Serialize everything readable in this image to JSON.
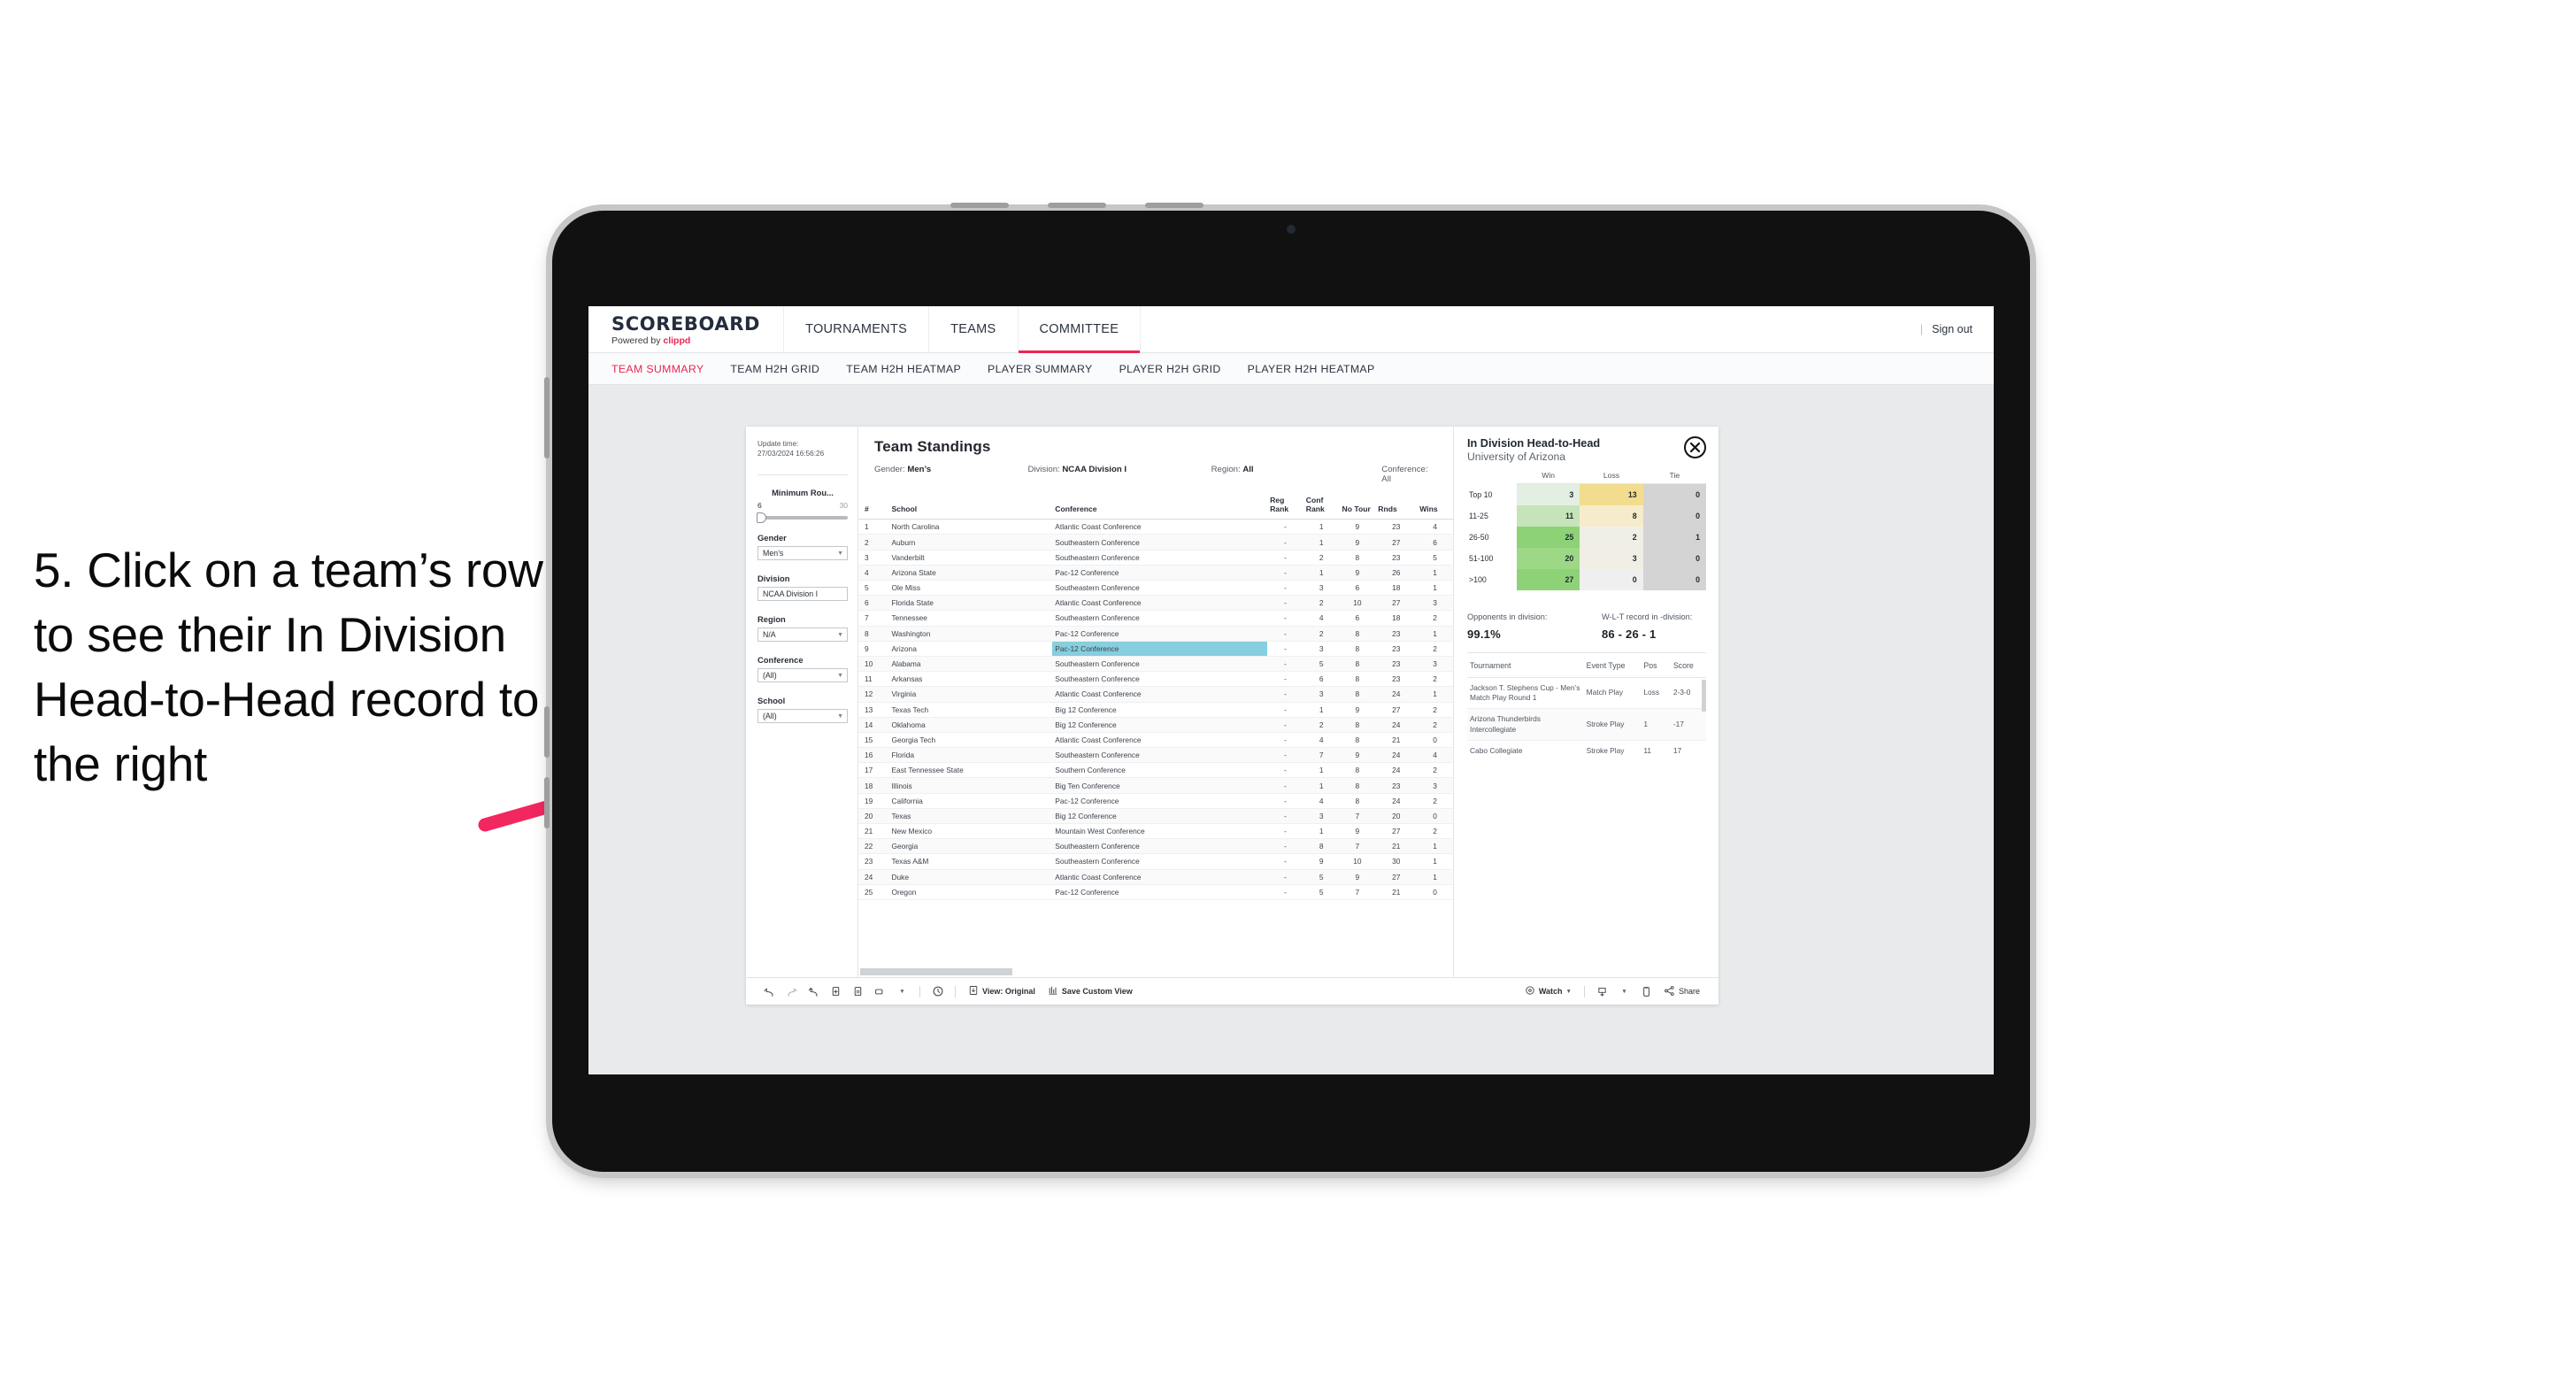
{
  "annotation": {
    "text": "5. Click on a team’s row to see their In Division Head-to-Head record to the right",
    "arrow_color": "#f2275f"
  },
  "app": {
    "brand": {
      "title": "SCOREBOARD",
      "powered_prefix": "Powered by ",
      "powered_brand": "clippd"
    },
    "top_nav": [
      {
        "label": "TOURNAMENTS",
        "active": false
      },
      {
        "label": "TEAMS",
        "active": false
      },
      {
        "label": "COMMITTEE",
        "active": true
      }
    ],
    "header_right": {
      "divider": "|",
      "sign_out": "Sign out"
    },
    "subtabs": [
      {
        "label": "TEAM SUMMARY",
        "active": true
      },
      {
        "label": "TEAM H2H GRID",
        "active": false
      },
      {
        "label": "TEAM H2H HEATMAP",
        "active": false
      },
      {
        "label": "PLAYER SUMMARY",
        "active": false
      },
      {
        "label": "PLAYER H2H GRID",
        "active": false
      },
      {
        "label": "PLAYER H2H HEATMAP",
        "active": false
      }
    ]
  },
  "filters": {
    "update_time_label": "Update time:",
    "update_time_value": "27/03/2024 16:56:26",
    "min_rounds": {
      "title": "Minimum Rou...",
      "min": "6",
      "max": "30"
    },
    "gender": {
      "title": "Gender",
      "value": "Men’s"
    },
    "division": {
      "title": "Division",
      "value": "NCAA Division I"
    },
    "region": {
      "title": "Region",
      "value": "N/A"
    },
    "conference": {
      "title": "Conference",
      "value": "(All)"
    },
    "school": {
      "title": "School",
      "value": "(All)"
    }
  },
  "standings": {
    "title": "Team Standings",
    "meta": [
      {
        "label": "Gender: ",
        "value": "Men’s"
      },
      {
        "label": "Division: ",
        "value": "NCAA Division I"
      },
      {
        "label": "Region: ",
        "value": "All"
      },
      {
        "label": "Conference: ",
        "value": "All"
      }
    ],
    "columns": [
      "#",
      "School",
      "Conference",
      "Reg Rank",
      "Conf Rank",
      "No Tour",
      "Rnds",
      "Wins"
    ],
    "rows": [
      {
        "n": "1",
        "school": "North Carolina",
        "conf": "Atlantic Coast Conference",
        "reg": "-",
        "cr": "1",
        "nt": "9",
        "rnds": "23",
        "wins": "4",
        "hl": false
      },
      {
        "n": "2",
        "school": "Auburn",
        "conf": "Southeastern Conference",
        "reg": "-",
        "cr": "1",
        "nt": "9",
        "rnds": "27",
        "wins": "6",
        "hl": false
      },
      {
        "n": "3",
        "school": "Vanderbilt",
        "conf": "Southeastern Conference",
        "reg": "-",
        "cr": "2",
        "nt": "8",
        "rnds": "23",
        "wins": "5",
        "hl": false
      },
      {
        "n": "4",
        "school": "Arizona State",
        "conf": "Pac-12 Conference",
        "reg": "-",
        "cr": "1",
        "nt": "9",
        "rnds": "26",
        "wins": "1",
        "hl": false
      },
      {
        "n": "5",
        "school": "Ole Miss",
        "conf": "Southeastern Conference",
        "reg": "-",
        "cr": "3",
        "nt": "6",
        "rnds": "18",
        "wins": "1",
        "hl": false
      },
      {
        "n": "6",
        "school": "Florida State",
        "conf": "Atlantic Coast Conference",
        "reg": "-",
        "cr": "2",
        "nt": "10",
        "rnds": "27",
        "wins": "3",
        "hl": false
      },
      {
        "n": "7",
        "school": "Tennessee",
        "conf": "Southeastern Conference",
        "reg": "-",
        "cr": "4",
        "nt": "6",
        "rnds": "18",
        "wins": "2",
        "hl": false
      },
      {
        "n": "8",
        "school": "Washington",
        "conf": "Pac-12 Conference",
        "reg": "-",
        "cr": "2",
        "nt": "8",
        "rnds": "23",
        "wins": "1",
        "hl": false
      },
      {
        "n": "9",
        "school": "Arizona",
        "conf": "Pac-12 Conference",
        "reg": "-",
        "cr": "3",
        "nt": "8",
        "rnds": "23",
        "wins": "2",
        "hl": true
      },
      {
        "n": "10",
        "school": "Alabama",
        "conf": "Southeastern Conference",
        "reg": "-",
        "cr": "5",
        "nt": "8",
        "rnds": "23",
        "wins": "3",
        "hl": false
      },
      {
        "n": "11",
        "school": "Arkansas",
        "conf": "Southeastern Conference",
        "reg": "-",
        "cr": "6",
        "nt": "8",
        "rnds": "23",
        "wins": "2",
        "hl": false
      },
      {
        "n": "12",
        "school": "Virginia",
        "conf": "Atlantic Coast Conference",
        "reg": "-",
        "cr": "3",
        "nt": "8",
        "rnds": "24",
        "wins": "1",
        "hl": false
      },
      {
        "n": "13",
        "school": "Texas Tech",
        "conf": "Big 12 Conference",
        "reg": "-",
        "cr": "1",
        "nt": "9",
        "rnds": "27",
        "wins": "2",
        "hl": false
      },
      {
        "n": "14",
        "school": "Oklahoma",
        "conf": "Big 12 Conference",
        "reg": "-",
        "cr": "2",
        "nt": "8",
        "rnds": "24",
        "wins": "2",
        "hl": false
      },
      {
        "n": "15",
        "school": "Georgia Tech",
        "conf": "Atlantic Coast Conference",
        "reg": "-",
        "cr": "4",
        "nt": "8",
        "rnds": "21",
        "wins": "0",
        "hl": false
      },
      {
        "n": "16",
        "school": "Florida",
        "conf": "Southeastern Conference",
        "reg": "-",
        "cr": "7",
        "nt": "9",
        "rnds": "24",
        "wins": "4",
        "hl": false
      },
      {
        "n": "17",
        "school": "East Tennessee State",
        "conf": "Southern Conference",
        "reg": "-",
        "cr": "1",
        "nt": "8",
        "rnds": "24",
        "wins": "2",
        "hl": false
      },
      {
        "n": "18",
        "school": "Illinois",
        "conf": "Big Ten Conference",
        "reg": "-",
        "cr": "1",
        "nt": "8",
        "rnds": "23",
        "wins": "3",
        "hl": false
      },
      {
        "n": "19",
        "school": "California",
        "conf": "Pac-12 Conference",
        "reg": "-",
        "cr": "4",
        "nt": "8",
        "rnds": "24",
        "wins": "2",
        "hl": false
      },
      {
        "n": "20",
        "school": "Texas",
        "conf": "Big 12 Conference",
        "reg": "-",
        "cr": "3",
        "nt": "7",
        "rnds": "20",
        "wins": "0",
        "hl": false
      },
      {
        "n": "21",
        "school": "New Mexico",
        "conf": "Mountain West Conference",
        "reg": "-",
        "cr": "1",
        "nt": "9",
        "rnds": "27",
        "wins": "2",
        "hl": false
      },
      {
        "n": "22",
        "school": "Georgia",
        "conf": "Southeastern Conference",
        "reg": "-",
        "cr": "8",
        "nt": "7",
        "rnds": "21",
        "wins": "1",
        "hl": false
      },
      {
        "n": "23",
        "school": "Texas A&M",
        "conf": "Southeastern Conference",
        "reg": "-",
        "cr": "9",
        "nt": "10",
        "rnds": "30",
        "wins": "1",
        "hl": false
      },
      {
        "n": "24",
        "school": "Duke",
        "conf": "Atlantic Coast Conference",
        "reg": "-",
        "cr": "5",
        "nt": "9",
        "rnds": "27",
        "wins": "1",
        "hl": false
      },
      {
        "n": "25",
        "school": "Oregon",
        "conf": "Pac-12 Conference",
        "reg": "-",
        "cr": "5",
        "nt": "7",
        "rnds": "21",
        "wins": "0",
        "hl": false
      }
    ]
  },
  "h2h": {
    "title": "In Division Head-to-Head",
    "subtitle": "University of Arizona",
    "close_icon": "close-icon",
    "columns": [
      "",
      "Win",
      "Loss",
      "Tie"
    ],
    "rows": [
      {
        "bucket": "Top 10",
        "win": "3",
        "loss": "13",
        "tie": "0",
        "win_color": "#e3efe3",
        "loss_color": "#f2dd8e",
        "tie_color": "#d4d4d4"
      },
      {
        "bucket": "11-25",
        "win": "11",
        "loss": "8",
        "tie": "0",
        "win_color": "#c6e4b9",
        "loss_color": "#f6eccb",
        "tie_color": "#d4d4d4"
      },
      {
        "bucket": "26-50",
        "win": "25",
        "loss": "2",
        "tie": "1",
        "win_color": "#8dd277",
        "loss_color": "#f0efe6",
        "tie_color": "#d4d4d4"
      },
      {
        "bucket": "51-100",
        "win": "20",
        "loss": "3",
        "tie": "0",
        "win_color": "#9cd885",
        "loss_color": "#f1efe5",
        "tie_color": "#d4d4d4"
      },
      {
        "bucket": ">100",
        "win": "27",
        "loss": "0",
        "tie": "0",
        "win_color": "#8ed278",
        "loss_color": "#efefef",
        "tie_color": "#d4d4d4"
      }
    ],
    "stats": [
      {
        "label": "Opponents in division:",
        "value": "99.1%"
      },
      {
        "label": "W-L-T record in -division:",
        "value": "86 - 26 - 1"
      }
    ],
    "tournament_columns": [
      "Tournament",
      "Event Type",
      "Pos",
      "Score"
    ],
    "tournaments": [
      {
        "name": "Jackson T. Stephens Cup - Men’s Match Play Round 1",
        "type": "Match Play",
        "pos": "Loss",
        "score": "2-3-0"
      },
      {
        "name": "Arizona Thunderbirds Intercollegiate",
        "type": "Stroke Play",
        "pos": "1",
        "score": "-17"
      },
      {
        "name": "Cabo Collegiate",
        "type": "Stroke Play",
        "pos": "11",
        "score": "17"
      }
    ]
  },
  "toolbar": {
    "icons": [
      "undo-icon",
      "redo-icon",
      "revert-icon",
      "refresh-data-icon",
      "pause-refresh-icon",
      "view-shape-icon"
    ],
    "alert_icon": "alert-clock-icon",
    "view_label": "View: Original",
    "view_icon": "view-original-icon",
    "save_label": "Save Custom View",
    "save_icon": "save-view-icon",
    "watch_label": "Watch",
    "watch_icon": "watch-icon",
    "download_icon": "download-icon",
    "device_icon": "device-icon",
    "share_label": "Share",
    "share_icon": "share-icon"
  }
}
